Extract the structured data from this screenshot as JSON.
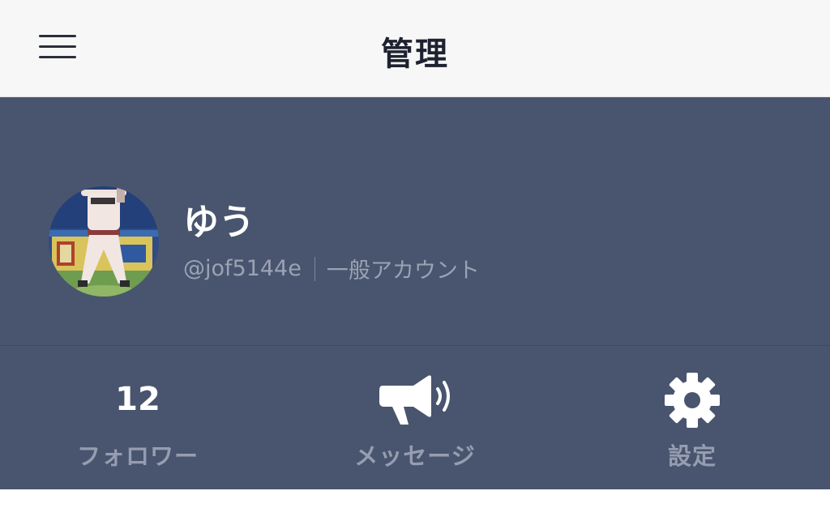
{
  "header": {
    "title": "管理"
  },
  "profile": {
    "name": "ゆう",
    "user_id": "@jof5144e",
    "account_type": "一般アカウント",
    "avatar_icon": "baseball-player-photo"
  },
  "stats": [
    {
      "value": "12",
      "label": "フォロワー"
    },
    {
      "icon": "megaphone-icon",
      "label": "メッセージ"
    },
    {
      "icon": "gear-icon",
      "label": "設定"
    }
  ],
  "colors": {
    "header_bg": "#f7f7f7",
    "profile_bg": "#49556e",
    "title_text": "#1e2230",
    "muted_text": "#959db0",
    "white": "#ffffff"
  }
}
